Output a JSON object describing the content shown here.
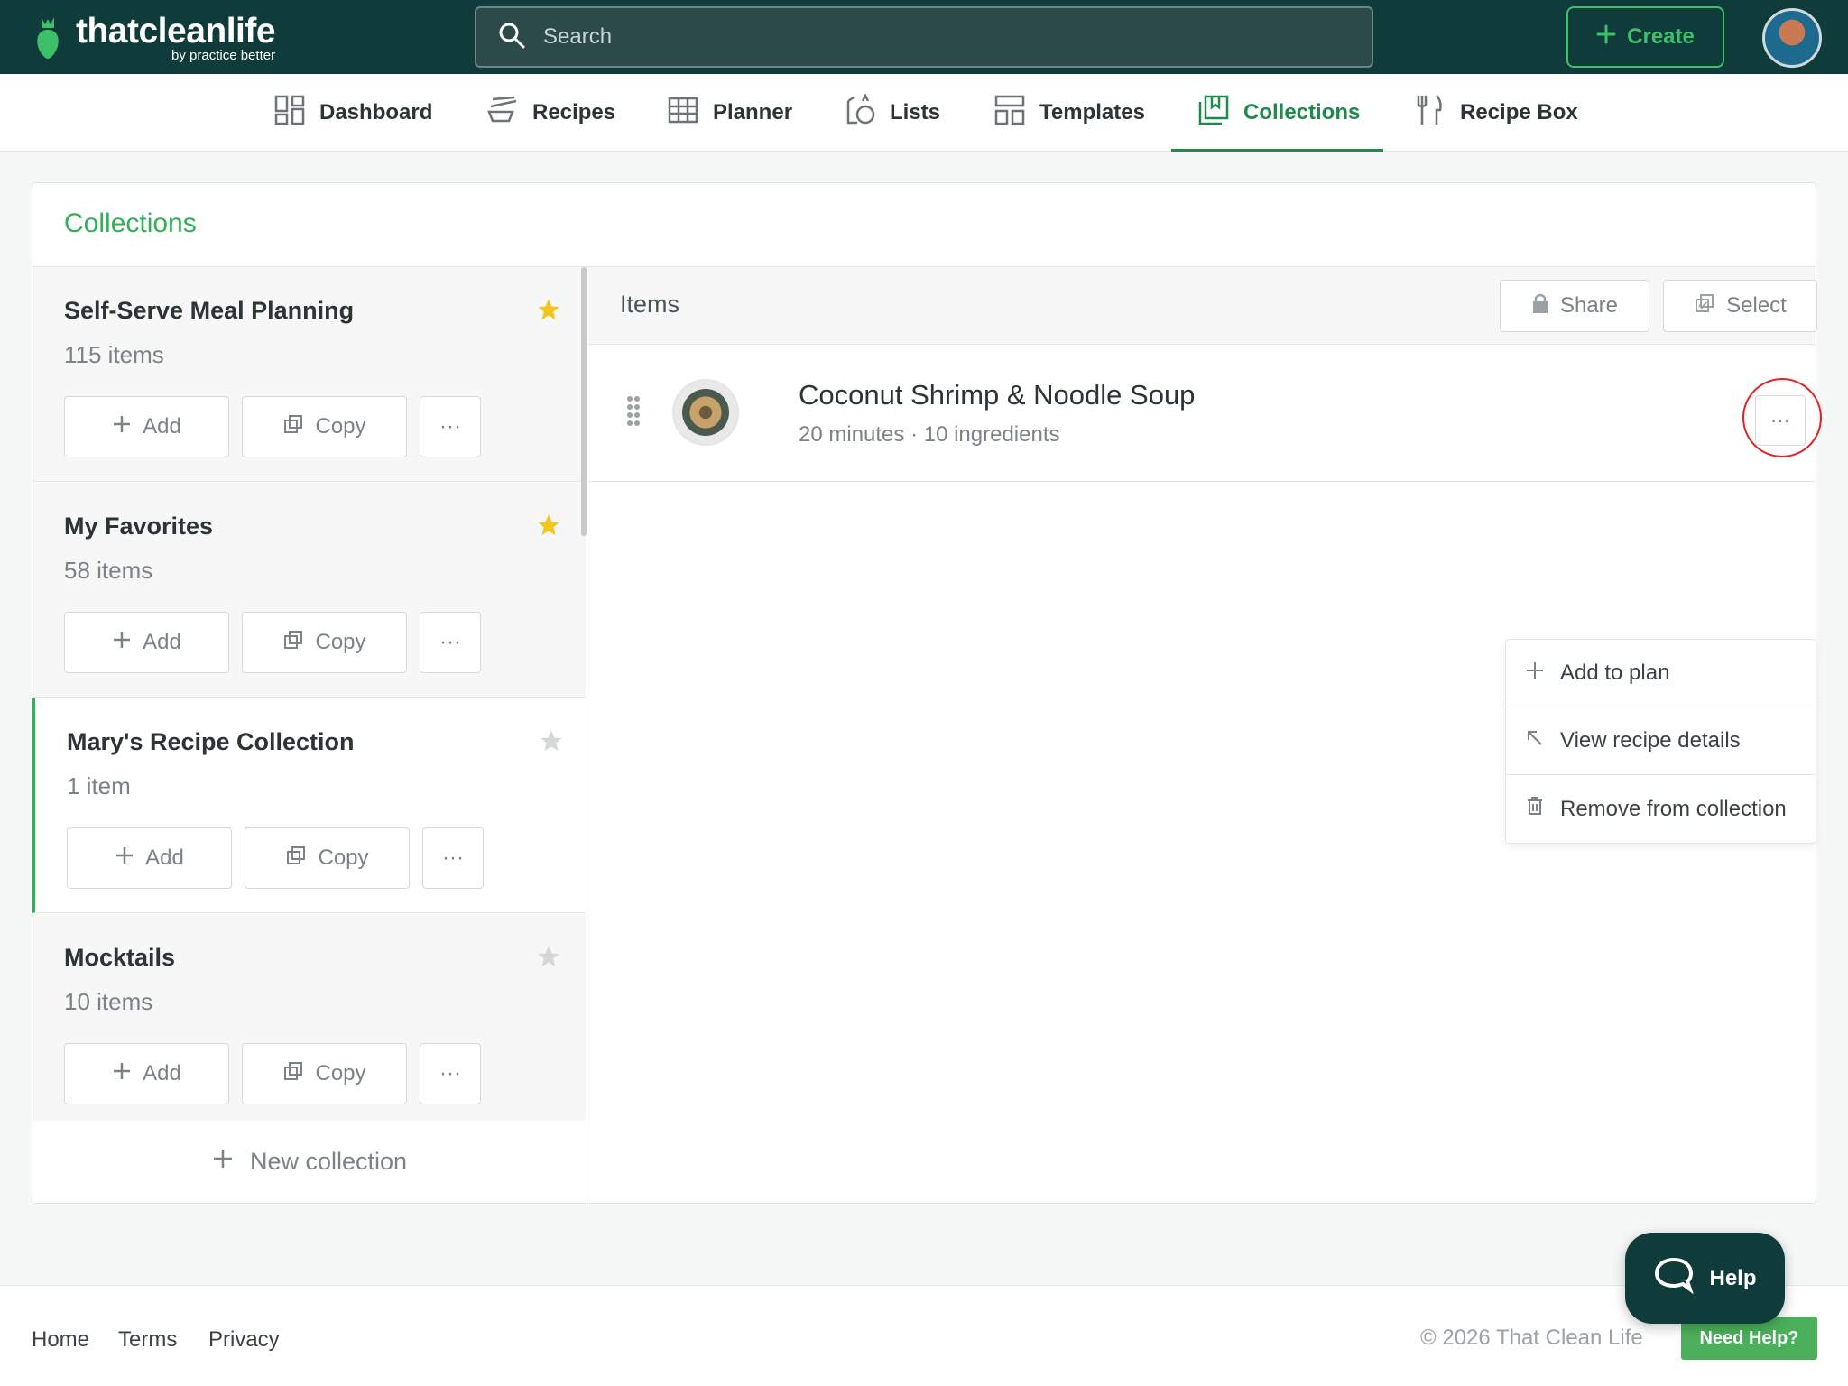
{
  "brand": {
    "name": "thatcleanlife",
    "sub": "by practice better"
  },
  "search": {
    "placeholder": "Search"
  },
  "create_label": "Create",
  "nav": [
    {
      "label": "Dashboard",
      "icon": "dashboard-icon"
    },
    {
      "label": "Recipes",
      "icon": "recipes-icon"
    },
    {
      "label": "Planner",
      "icon": "planner-icon"
    },
    {
      "label": "Lists",
      "icon": "lists-icon"
    },
    {
      "label": "Templates",
      "icon": "templates-icon"
    },
    {
      "label": "Collections",
      "icon": "collections-icon",
      "active": true
    },
    {
      "label": "Recipe Box",
      "icon": "recipe-box-icon"
    }
  ],
  "page_title": "Collections",
  "collections": [
    {
      "name": "Self-Serve Meal Planning",
      "count": "115 items",
      "starred": true
    },
    {
      "name": "My Favorites",
      "count": "58 items",
      "starred": true
    },
    {
      "name": "Mary's Recipe Collection",
      "count": "1 item",
      "starred": false,
      "selected": true
    },
    {
      "name": "Mocktails",
      "count": "10 items",
      "starred": false
    }
  ],
  "collection_actions": {
    "add": "Add",
    "copy": "Copy",
    "more": "···"
  },
  "new_collection": "New collection",
  "items_panel": {
    "title": "Items",
    "share": "Share",
    "select": "Select"
  },
  "item": {
    "name": "Coconut Shrimp & Noodle Soup",
    "meta": "20 minutes · 10 ingredients"
  },
  "item_menu": [
    {
      "label": "Add to plan",
      "icon": "plus-icon"
    },
    {
      "label": "View recipe details",
      "icon": "arrow-up-left-icon"
    },
    {
      "label": "Remove from collection",
      "icon": "trash-icon"
    }
  ],
  "footer": {
    "links": [
      "Home",
      "Terms",
      "Privacy"
    ],
    "copyright": "© 2026 That Clean Life",
    "need_help": "Need Help?"
  },
  "help_label": "Help",
  "colors": {
    "topbar": "#0f3b3a",
    "accent": "#1f8a4c",
    "title_green": "#2fb155",
    "star": "#f5c518"
  }
}
